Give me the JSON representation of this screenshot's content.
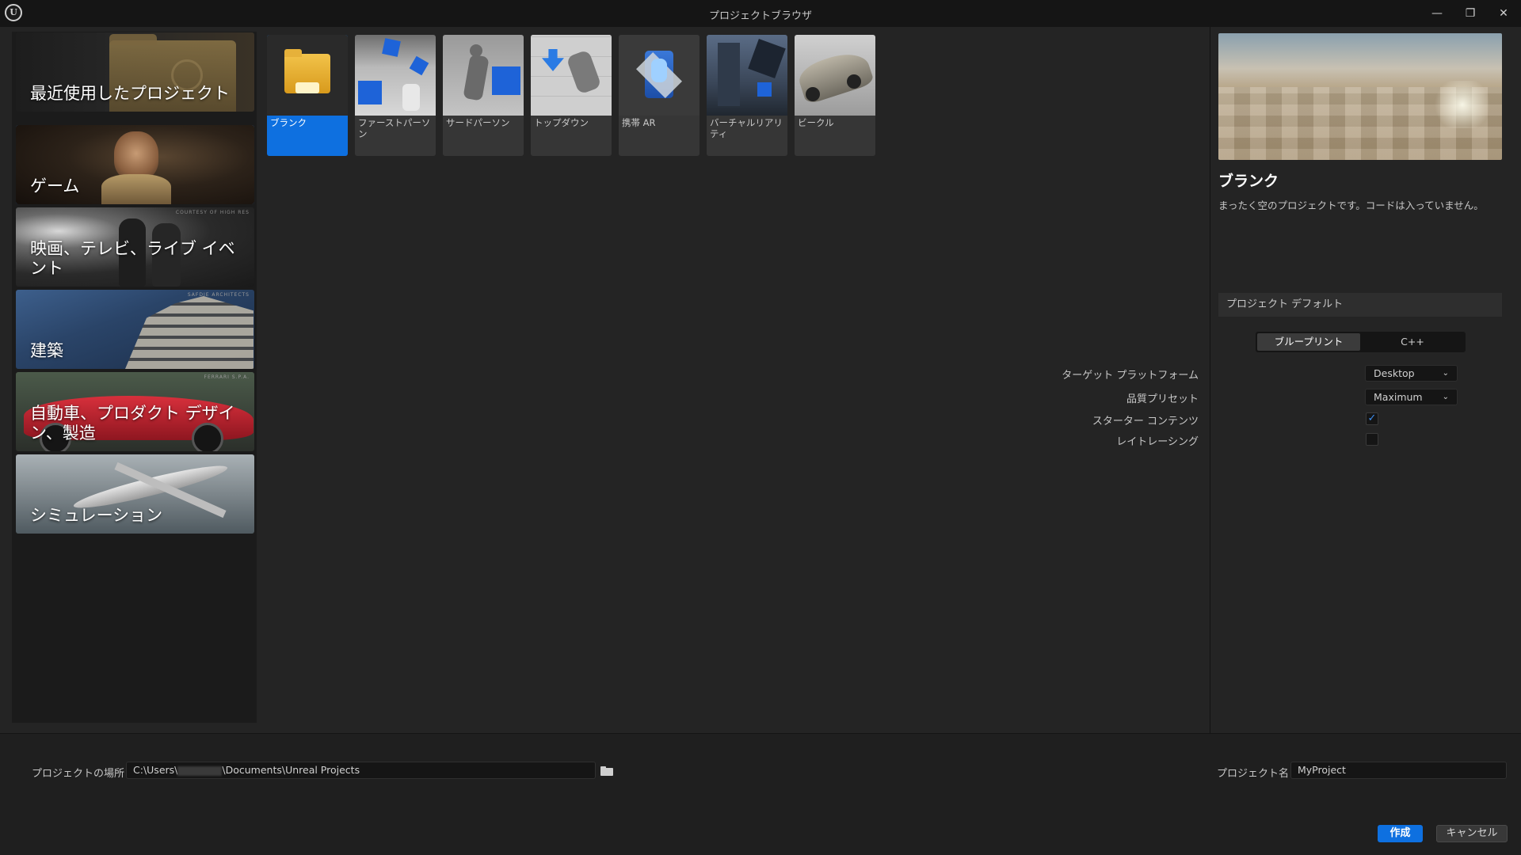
{
  "window": {
    "title": "プロジェクトブラウザ",
    "logo_text": "U",
    "controls": {
      "minimize": "—",
      "restore": "❐",
      "close": "✕"
    }
  },
  "categories": [
    {
      "label": "最近使用したプロジェクト",
      "selected": false
    },
    {
      "label": "ゲーム",
      "selected": true
    },
    {
      "label": "映画、テレビ、ライブ イベント",
      "watermark": "COURTESY OF HIGH RES",
      "selected": false
    },
    {
      "label": "建築",
      "watermark": "SAFDIE ARCHITECTS",
      "selected": false
    },
    {
      "label": "自動車、プロダクト デザイン、製造",
      "watermark": "FERRARI S.P.A.",
      "selected": false
    },
    {
      "label": "シミュレーション",
      "selected": false
    }
  ],
  "templates": [
    {
      "label": "ブランク",
      "icon": "blank-folder-icon",
      "selected": true
    },
    {
      "label": "ファーストパーソン",
      "icon": "first-person-thumb"
    },
    {
      "label": "サードパーソン",
      "icon": "third-person-thumb"
    },
    {
      "label": "トップダウン",
      "icon": "top-down-thumb"
    },
    {
      "label": "携帯 AR",
      "icon": "handheld-ar-thumb"
    },
    {
      "label": "バーチャルリアリティ",
      "icon": "virtual-reality-thumb"
    },
    {
      "label": "ビークル",
      "icon": "vehicle-thumb"
    }
  ],
  "details": {
    "title": "ブランク",
    "description": "まったく空のプロジェクトです。コードは入っていません。",
    "defaults_header": "プロジェクト デフォルト",
    "language_options": [
      "ブループリント",
      "C++"
    ],
    "language_selected": "ブループリント",
    "settings": {
      "target_platform_label": "ターゲット プラットフォーム",
      "target_platform_value": "Desktop",
      "quality_label": "品質プリセット",
      "quality_value": "Maximum",
      "starter_content_label": "スターター コンテンツ",
      "starter_content_checked": true,
      "raytracing_label": "レイトレーシング",
      "raytracing_checked": false
    }
  },
  "bottom": {
    "location_label": "プロジェクトの場所",
    "location_value_prefix": "C:\\Users\\",
    "location_value_suffix": "\\Documents\\Unreal Projects",
    "name_label": "プロジェクト名",
    "name_value": "MyProject",
    "create_label": "作成",
    "cancel_label": "キャンセル"
  },
  "colors": {
    "accent": "#0e70e0",
    "background": "#242424",
    "panel": "#1b1b1b",
    "titlebar": "#151515"
  }
}
